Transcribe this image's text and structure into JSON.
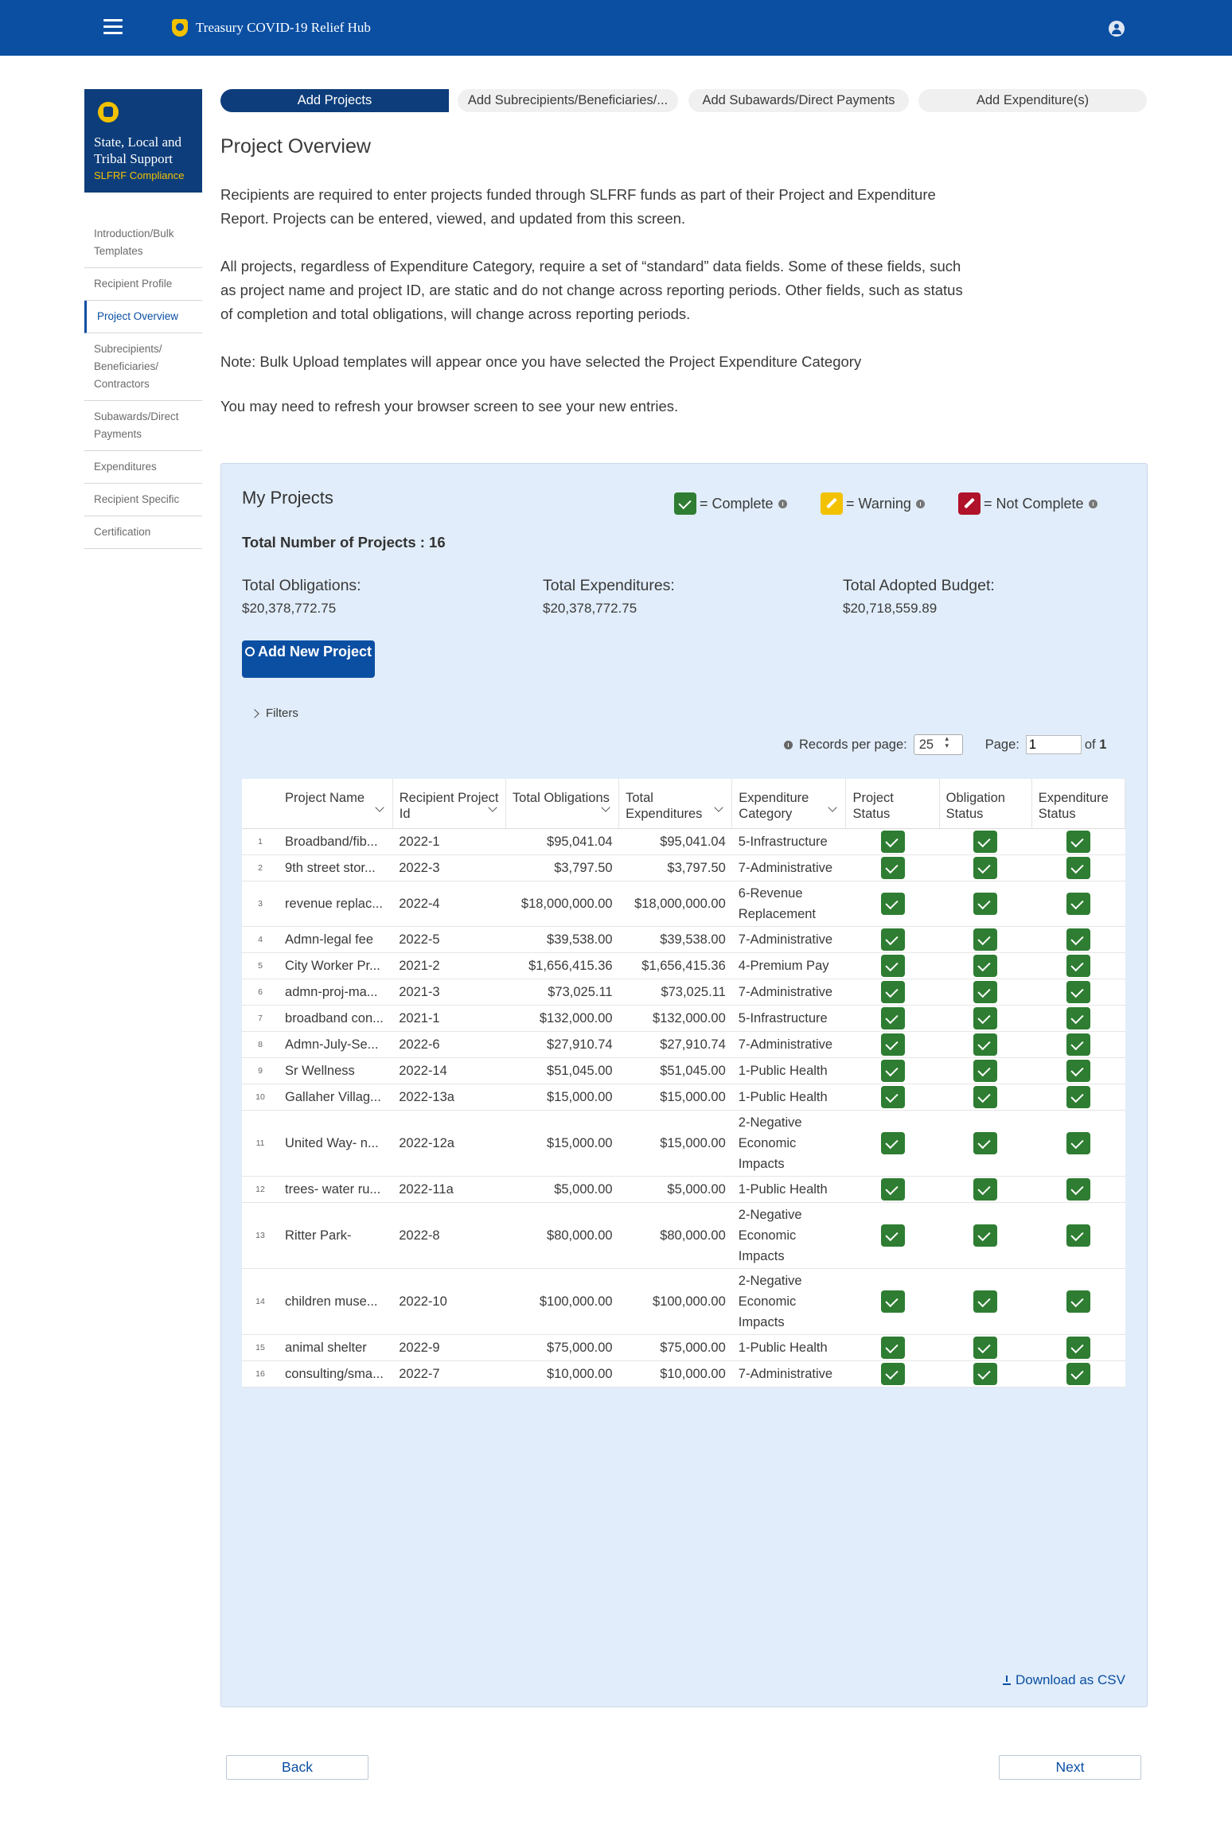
{
  "header": {
    "app_title": "Treasury COVID-19 Relief Hub"
  },
  "brand": {
    "name": "State, Local and Tribal Support",
    "sub": "SLFRF Compliance"
  },
  "sidebar": {
    "items": [
      {
        "label": "Introduction/Bulk Templates",
        "active": false
      },
      {
        "label": "Recipient Profile",
        "active": false
      },
      {
        "label": "Project Overview",
        "active": true
      },
      {
        "label": "Subrecipients/ Beneficiaries/ Contractors",
        "active": false
      },
      {
        "label": "Subawards/Direct Payments",
        "active": false
      },
      {
        "label": "Expenditures",
        "active": false
      },
      {
        "label": "Recipient Specific",
        "active": false
      },
      {
        "label": "Certification",
        "active": false
      }
    ]
  },
  "tabs": [
    {
      "label": "Add Projects",
      "active": true
    },
    {
      "label": "Add Subrecipients/Beneficiaries/...",
      "active": false
    },
    {
      "label": "Add Subawards/Direct Payments",
      "active": false
    },
    {
      "label": "Add Expenditure(s)",
      "active": false
    }
  ],
  "main": {
    "title": "Project Overview",
    "para1": "Recipients are required to enter projects funded through SLFRF funds as part of their Project and Expenditure Report. Projects can be entered, viewed, and updated from this screen.",
    "para2": "All projects, regardless of Expenditure Category, require a set of “standard” data fields. Some of these fields, such as project name and project ID, are static and do not change across reporting periods. Other fields, such as status of completion and total obligations, will change across reporting periods.",
    "para3": "Note: Bulk Upload templates will appear once you have selected the Project Expenditure Category",
    "para4": "You may need to refresh your browser screen to see your new entries."
  },
  "projects": {
    "title": "My Projects",
    "legend": {
      "complete": "= Complete",
      "warning": "= Warning",
      "not_complete": "= Not Complete"
    },
    "total_projects": "Total Number of Projects : 16",
    "obligations_label": "Total Obligations:",
    "obligations_value": "$20,378,772.75",
    "expenditures_label": "Total Expenditures:",
    "expenditures_value": "$20,378,772.75",
    "budget_label": "Total Adopted Budget:",
    "budget_value": "$20,718,559.89",
    "add_button": "Add New Project",
    "filters_label": "Filters",
    "records_label": "Records per page:",
    "records_value": "25",
    "page_label": "Page:",
    "page_value": "1",
    "page_of": "of",
    "page_total": "1",
    "download_label": "Download as CSV",
    "columns": [
      "Project Name",
      "Recipient Project Id",
      "Total Obligations",
      "Total Expenditures",
      "Expenditure Category",
      "Project Status",
      "Obligation Status",
      "Expenditure Status"
    ],
    "rows": [
      {
        "n": "1",
        "name": "Broadband/fib...",
        "id": "2022-1",
        "obl": "$95,041.04",
        "exp": "$95,041.04",
        "cat": "5-Infrastructure"
      },
      {
        "n": "2",
        "name": "9th street stor...",
        "id": "2022-3",
        "obl": "$3,797.50",
        "exp": "$3,797.50",
        "cat": "7-Administrative"
      },
      {
        "n": "3",
        "name": "revenue replac...",
        "id": "2022-4",
        "obl": "$18,000,000.00",
        "exp": "$18,000,000.00",
        "cat": "6-Revenue Replacement"
      },
      {
        "n": "4",
        "name": "Admn-legal fee",
        "id": "2022-5",
        "obl": "$39,538.00",
        "exp": "$39,538.00",
        "cat": "7-Administrative"
      },
      {
        "n": "5",
        "name": "City Worker Pr...",
        "id": "2021-2",
        "obl": "$1,656,415.36",
        "exp": "$1,656,415.36",
        "cat": "4-Premium Pay"
      },
      {
        "n": "6",
        "name": "admn-proj-ma...",
        "id": "2021-3",
        "obl": "$73,025.11",
        "exp": "$73,025.11",
        "cat": "7-Administrative"
      },
      {
        "n": "7",
        "name": "broadband con...",
        "id": "2021-1",
        "obl": "$132,000.00",
        "exp": "$132,000.00",
        "cat": "5-Infrastructure"
      },
      {
        "n": "8",
        "name": "Admn-July-Se...",
        "id": "2022-6",
        "obl": "$27,910.74",
        "exp": "$27,910.74",
        "cat": "7-Administrative"
      },
      {
        "n": "9",
        "name": "Sr Wellness",
        "id": "2022-14",
        "obl": "$51,045.00",
        "exp": "$51,045.00",
        "cat": "1-Public Health"
      },
      {
        "n": "10",
        "name": "Gallaher Villag...",
        "id": "2022-13a",
        "obl": "$15,000.00",
        "exp": "$15,000.00",
        "cat": "1-Public Health"
      },
      {
        "n": "11",
        "name": "United Way- n...",
        "id": "2022-12a",
        "obl": "$15,000.00",
        "exp": "$15,000.00",
        "cat": "2-Negative Economic Impacts"
      },
      {
        "n": "12",
        "name": "trees- water ru...",
        "id": "2022-11a",
        "obl": "$5,000.00",
        "exp": "$5,000.00",
        "cat": "1-Public Health"
      },
      {
        "n": "13",
        "name": "Ritter Park-",
        "id": "2022-8",
        "obl": "$80,000.00",
        "exp": "$80,000.00",
        "cat": "2-Negative Economic Impacts"
      },
      {
        "n": "14",
        "name": "children muse...",
        "id": "2022-10",
        "obl": "$100,000.00",
        "exp": "$100,000.00",
        "cat": "2-Negative Economic Impacts"
      },
      {
        "n": "15",
        "name": "animal shelter",
        "id": "2022-9",
        "obl": "$75,000.00",
        "exp": "$75,000.00",
        "cat": "1-Public Health"
      },
      {
        "n": "16",
        "name": "consulting/sma...",
        "id": "2022-7",
        "obl": "$10,000.00",
        "exp": "$10,000.00",
        "cat": "7-Administrative"
      }
    ]
  },
  "footer": {
    "back": "Back",
    "next": "Next"
  },
  "colors": {
    "primary": "#0b4fa3",
    "navy": "#0d3d7a",
    "gold": "#f2c200",
    "complete": "#2e7d32",
    "warning": "#f2c200",
    "not_complete": "#b0122a",
    "panel": "#e1edfa"
  }
}
